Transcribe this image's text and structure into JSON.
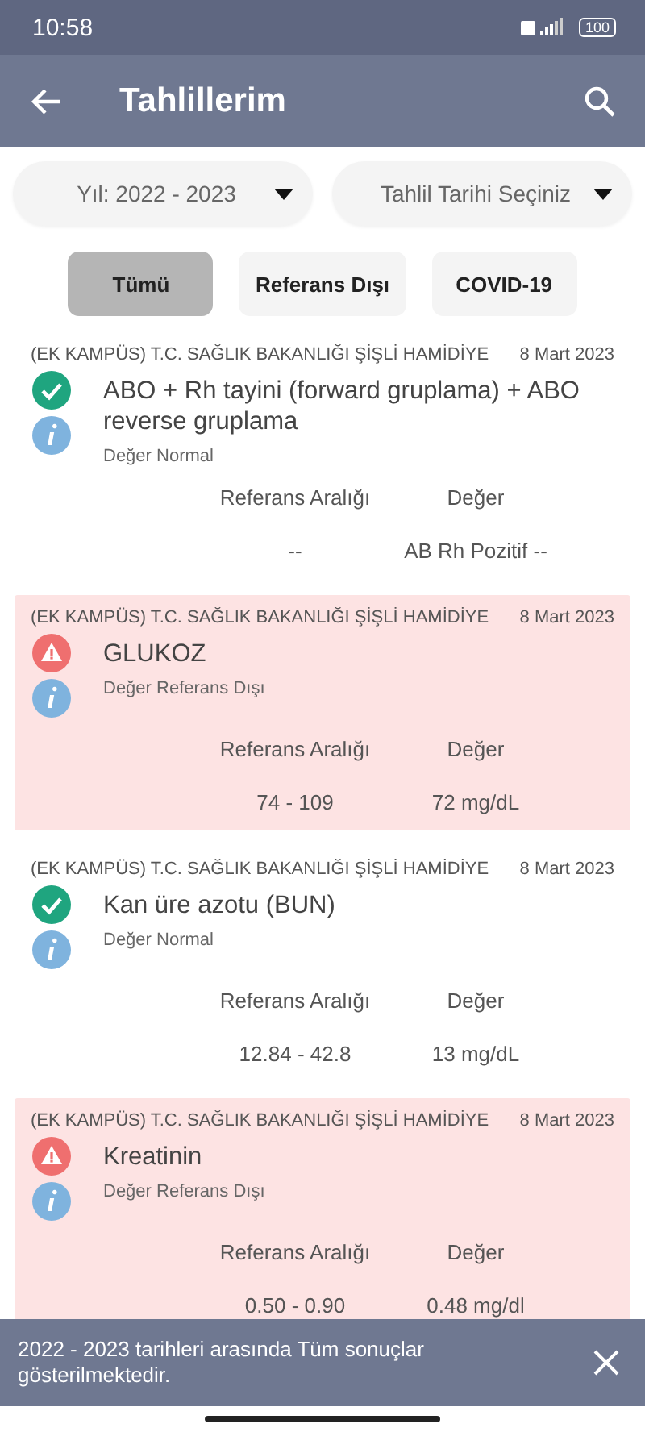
{
  "status_bar": {
    "time": "10:58",
    "battery": "100"
  },
  "header": {
    "title": "Tahlillerim"
  },
  "dropdowns": [
    {
      "value": "Yıl: 2022 - 2023"
    },
    {
      "value": "Tahlil Tarihi Seçiniz"
    }
  ],
  "filters": [
    {
      "label": "Tümü",
      "selected": true
    },
    {
      "label": "Referans Dışı",
      "selected": false
    },
    {
      "label": "COVID-19",
      "selected": false
    }
  ],
  "results": [
    {
      "hospital": "(EK KAMPÜS) T.C. SAĞLIK BAKANLIĞI ŞİŞLİ HAMİDİYE",
      "date": "8 Mart 2023",
      "test": "ABO + Rh tayini (forward gruplama) + ABO reverse gruplama",
      "out_of_range": false,
      "status": "Değer Normal",
      "range_label": "Referans Aralığı",
      "value_label": "Değer",
      "range": "--",
      "value": "AB Rh Pozitif --"
    },
    {
      "hospital": "(EK KAMPÜS) T.C. SAĞLIK BAKANLIĞI ŞİŞLİ HAMİDİYE",
      "date": "8 Mart 2023",
      "test": "GLUKOZ",
      "out_of_range": true,
      "status": "Değer Referans Dışı",
      "range_label": "Referans Aralığı",
      "value_label": "Değer",
      "range": "74 - 109",
      "value": "72 mg/dL"
    },
    {
      "hospital": "(EK KAMPÜS) T.C. SAĞLIK BAKANLIĞI ŞİŞLİ HAMİDİYE",
      "date": "8 Mart 2023",
      "test": "Kan üre azotu (BUN)",
      "out_of_range": false,
      "status": "Değer Normal",
      "range_label": "Referans Aralığı",
      "value_label": "Değer",
      "range": "12.84 - 42.8",
      "value": "13 mg/dL"
    },
    {
      "hospital": "(EK KAMPÜS) T.C. SAĞLIK BAKANLIĞI ŞİŞLİ HAMİDİYE",
      "date": "8 Mart 2023",
      "test": "Kreatinin",
      "out_of_range": true,
      "status": "Değer Referans Dışı",
      "range_label": "Referans Aralığı",
      "value_label": "Değer",
      "range": "0.50 - 0.90",
      "value": "0.48 mg/dl"
    }
  ],
  "snackbar": {
    "message": "2022 - 2023 tarihleri arasında Tüm sonuçlar gösterilmektedir."
  }
}
